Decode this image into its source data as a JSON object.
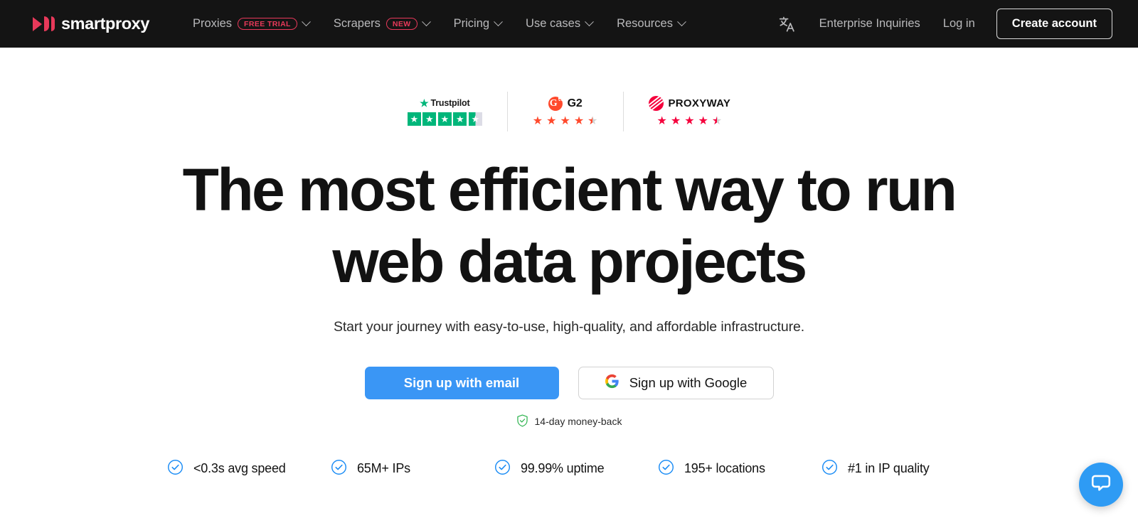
{
  "brand": {
    "name": "smartproxy",
    "logo_icon": "smartproxy-logo-icon",
    "accent_red": "#e8395a"
  },
  "navbar": {
    "background": "#141414",
    "items": [
      {
        "label": "Proxies",
        "badge": "FREE TRIAL",
        "has_dropdown": true
      },
      {
        "label": "Scrapers",
        "badge": "NEW",
        "has_dropdown": true
      },
      {
        "label": "Pricing",
        "badge": "",
        "has_dropdown": true
      },
      {
        "label": "Use cases",
        "badge": "",
        "has_dropdown": true
      },
      {
        "label": "Resources",
        "badge": "",
        "has_dropdown": true
      }
    ],
    "language_icon": "language-translate-icon",
    "enterprise_link": "Enterprise Inquiries",
    "login_link": "Log in",
    "create_account_button": "Create account"
  },
  "trust_badges": [
    {
      "id": "trustpilot",
      "name": "Trustpilot",
      "icon": "trustpilot-star-icon",
      "rating": 4.5,
      "max_rating": 5,
      "color": "#00b67a",
      "style": "boxes"
    },
    {
      "id": "g2",
      "name": "G2",
      "icon": "g2-logo-icon",
      "rating": 4.5,
      "max_rating": 5,
      "color": "#ff492c",
      "style": "stars"
    },
    {
      "id": "proxyway",
      "name": "PROXYWAY",
      "icon": "proxyway-logo-icon",
      "rating": 4.5,
      "max_rating": 5,
      "color": "#f5003c",
      "style": "stars"
    }
  ],
  "hero": {
    "headline_line1": "The most efficient way to run",
    "headline_line2": "web data projects",
    "subheadline": "Start your journey with easy-to-use, high-quality, and affordable infrastructure.",
    "primary_cta": "Sign up with email",
    "secondary_cta": "Sign up with Google",
    "secondary_cta_icon": "google-g-icon",
    "guarantee_text": "14-day money-back",
    "guarantee_icon": "shield-check-icon",
    "primary_cta_color": "#3a96f5",
    "guarantee_color": "#2bb24c"
  },
  "features": {
    "check_icon": "check-circle-icon",
    "check_color": "#1a8cf5",
    "items": [
      {
        "label": "<0.3s avg speed"
      },
      {
        "label": "65M+ IPs"
      },
      {
        "label": "99.99% uptime"
      },
      {
        "label": "195+ locations"
      },
      {
        "label": "#1 in IP quality"
      }
    ]
  },
  "chat_widget": {
    "icon": "chat-bubble-icon",
    "color": "#2e9bf4",
    "label": "Open live chat"
  }
}
